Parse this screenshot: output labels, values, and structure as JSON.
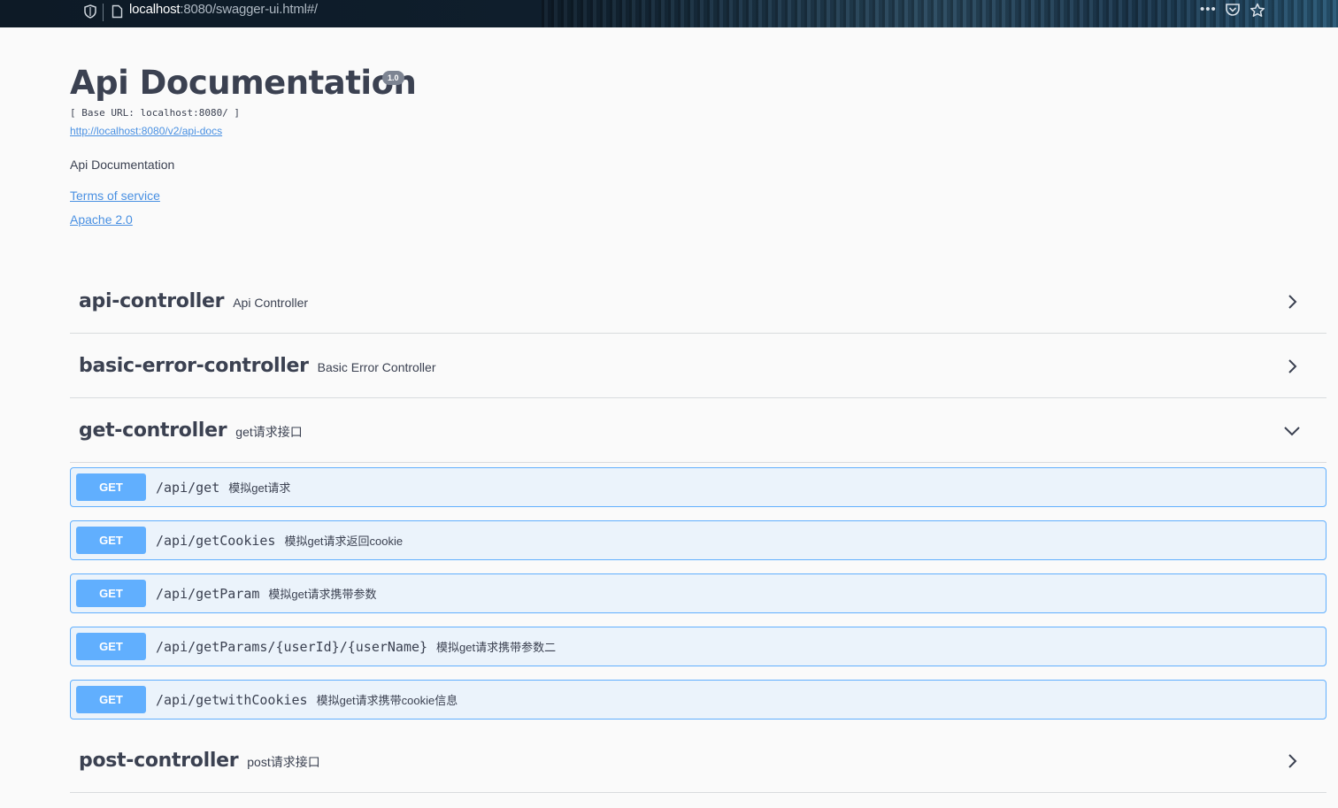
{
  "browser": {
    "url_host": "localhost",
    "url_rest": ":8080/swagger-ui.html#/",
    "icons": [
      "shield-icon",
      "page-icon",
      "more-icon",
      "pocket-icon",
      "bookmark-star-icon"
    ]
  },
  "info": {
    "title": "Api Documentation",
    "version": "1.0",
    "base_url": "[ Base URL: localhost:8080/ ]",
    "docs_url": "http://localhost:8080/v2/api-docs",
    "description": "Api Documentation",
    "terms": "Terms of service",
    "license": "Apache 2.0"
  },
  "tags": [
    {
      "name": "api-controller",
      "description": "Api Controller",
      "expanded": false
    },
    {
      "name": "basic-error-controller",
      "description": "Basic Error Controller",
      "expanded": false
    },
    {
      "name": "get-controller",
      "description": "get请求接口",
      "expanded": true
    },
    {
      "name": "post-controller",
      "description": "post请求接口",
      "expanded": false
    }
  ],
  "operations": [
    {
      "method": "GET",
      "path": "/api/get",
      "summary": "模拟get请求"
    },
    {
      "method": "GET",
      "path": "/api/getCookies",
      "summary": "模拟get请求返回cookie"
    },
    {
      "method": "GET",
      "path": "/api/getParam",
      "summary": "模拟get请求携带参数"
    },
    {
      "method": "GET",
      "path": "/api/getParams/{userId}/{userName}",
      "summary": "模拟get请求携带参数二"
    },
    {
      "method": "GET",
      "path": "/api/getwithCookies",
      "summary": "模拟get请求携带cookie信息"
    }
  ],
  "colors": {
    "get_accent": "#61affe",
    "get_bg": "#ebf3fb",
    "link": "#4990e2",
    "text": "#3b4151"
  }
}
